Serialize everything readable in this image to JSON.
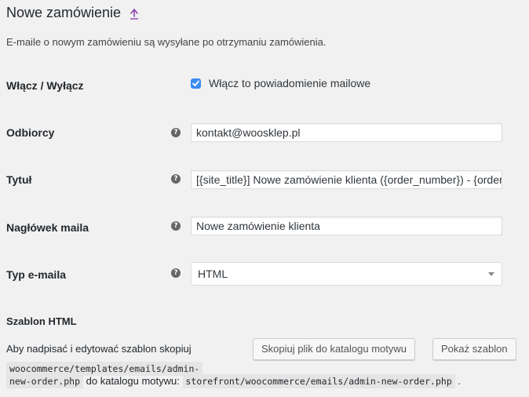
{
  "header": {
    "title": "Nowe zamówienie",
    "up_icon": "up-arrow-icon"
  },
  "description": "E-maile o nowym zamówieniu są wysyłane po otrzymaniu zamówienia.",
  "fields": {
    "enable": {
      "label": "Włącz / Wyłącz",
      "checkbox_label": "Włącz to powiadomienie mailowe",
      "checked": true
    },
    "recipients": {
      "label": "Odbiorcy",
      "value": "kontakt@woosklep.pl"
    },
    "subject": {
      "label": "Tytuł",
      "value": "[{site_title}] Nowe zamówienie klienta ({order_number}) - {order_date}"
    },
    "heading": {
      "label": "Nagłówek maila",
      "value": "Nowe zamówienie klienta"
    },
    "email_type": {
      "label": "Typ e-maila",
      "selected": "HTML"
    }
  },
  "template": {
    "title": "Szablon HTML",
    "text_before": "Aby nadpisać i edytować szablon skopiuj",
    "source_path_1": "woocommerce/templates/emails/admin-",
    "source_path_2": "new-order.php",
    "text_middle": "do katalogu motywu:",
    "dest_path": "storefront/woocommerce/emails/admin-new-order.php",
    "text_end": ".",
    "copy_button": "Skopiuj plik do katalogu motywu",
    "show_button": "Pokaż szablon"
  },
  "colors": {
    "checkbox": "#3b8cf0",
    "up_arrow": "#8e44ad"
  }
}
